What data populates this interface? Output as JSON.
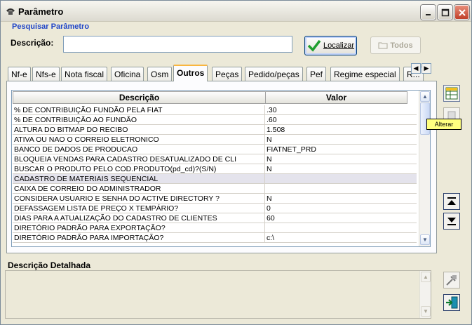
{
  "window": {
    "title": "Parâmetro"
  },
  "search": {
    "group_title": "Pesquisar Parâmetro",
    "descricao_label": "Descrição:",
    "descricao_value": "",
    "localizar_label": "Localizar",
    "todos_label": "Todos"
  },
  "tabs": [
    {
      "label": "Nf-e",
      "active": false
    },
    {
      "label": "Nfs-e",
      "active": false
    },
    {
      "label": "Nota fiscal",
      "active": false
    },
    {
      "label": "Oficina",
      "active": false
    },
    {
      "label": "Osm",
      "active": false
    },
    {
      "label": "Outros",
      "active": true
    },
    {
      "label": "Peças",
      "active": false
    },
    {
      "label": "Pedido/peças",
      "active": false
    },
    {
      "label": "Pef",
      "active": false
    },
    {
      "label": "Regime especial",
      "active": false
    },
    {
      "label": "R...",
      "active": false
    }
  ],
  "grid": {
    "columns": [
      "Descrição",
      "Valor"
    ],
    "rows": [
      {
        "descricao": "% DE CONTRIBUIÇÃO FUNDÃO PELA FIAT",
        "valor": ".30"
      },
      {
        "descricao": "% DE CONTRIBUIÇÃO AO FUNDÃO",
        "valor": ".60"
      },
      {
        "descricao": "ALTURA DO BITMAP DO RECIBO",
        "valor": "1.508"
      },
      {
        "descricao": "ATIVA OU NAO O CORREIO ELETRONICO",
        "valor": "N"
      },
      {
        "descricao": "BANCO DE DADOS DE PRODUCAO",
        "valor": "FIATNET_PRD"
      },
      {
        "descricao": "BLOQUEIA VENDAS PARA CADASTRO DESATUALIZADO DE CLI",
        "valor": "N"
      },
      {
        "descricao": "BUSCAR O PRODUTO PELO COD.PRODUTO(pd_cd)?(S/N)",
        "valor": "N"
      },
      {
        "descricao": "CADASTRO DE MATERIAIS SEQUENCIAL",
        "valor": ""
      },
      {
        "descricao": "CAIXA DE CORREIO DO ADMINISTRADOR",
        "valor": ""
      },
      {
        "descricao": "CONSIDERA USUARIO E SENHA DO ACTIVE DIRECTORY ?",
        "valor": "N"
      },
      {
        "descricao": "DEFASSAGEM LISTA DE PREÇO X TEMPÁRIO?",
        "valor": "0"
      },
      {
        "descricao": "DIAS PARA A ATUALIZAÇÃO DO CADASTRO DE CLIENTES",
        "valor": "60"
      },
      {
        "descricao": "DIRETÓRIO PADRÃO PARA EXPORTAÇÃO?",
        "valor": ""
      },
      {
        "descricao": "DIRETÓRIO PADRÃO PARA IMPORTAÇÃO?",
        "valor": "c:\\"
      }
    ],
    "selected_row": 7
  },
  "detail": {
    "label": "Descrição Detalhada",
    "value": ""
  },
  "sidebar": {
    "alterar_tooltip": "Alterar"
  },
  "colors": {
    "accent": "#2045c8",
    "tab_highlight": "#f9b63f",
    "tooltip_bg": "#ffff80"
  }
}
